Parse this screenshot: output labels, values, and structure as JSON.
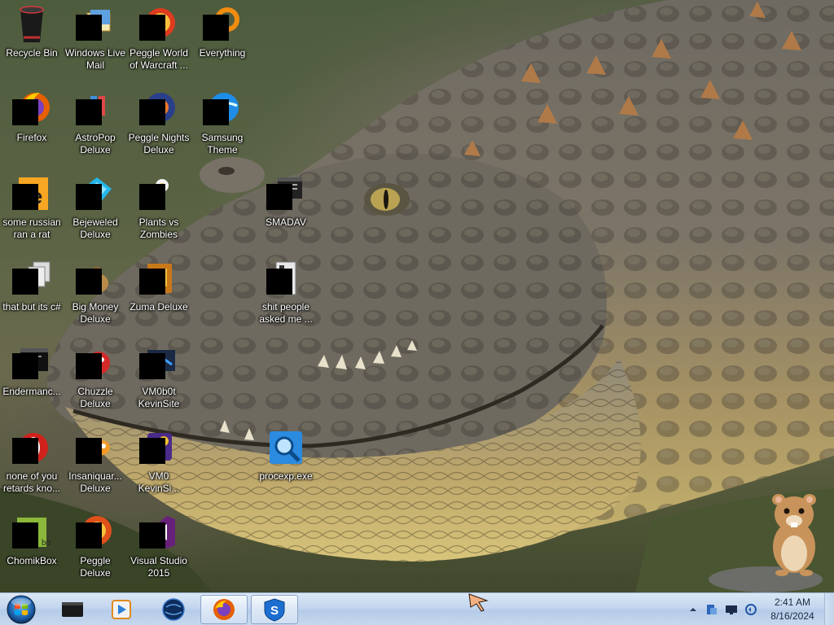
{
  "desktop_icons": [
    {
      "id": "recycle-bin",
      "label": "Recycle Bin",
      "icon": "recycle-bin-icon",
      "redacted": false
    },
    {
      "id": "windows-live-mail",
      "label": "Windows Live Mail",
      "icon": "mail-icon",
      "redacted": true
    },
    {
      "id": "peggle-world-of-warcraft",
      "label": "Peggle World of Warcraft ...",
      "icon": "peggle-wow-icon",
      "redacted": true
    },
    {
      "id": "everything",
      "label": "Everything",
      "icon": "everything-search-icon",
      "redacted": true
    },
    {
      "id": "firefox",
      "label": "Firefox",
      "icon": "firefox-icon",
      "redacted": true
    },
    {
      "id": "astropop-deluxe",
      "label": "AstroPop Deluxe",
      "icon": "astropop-icon",
      "redacted": true
    },
    {
      "id": "peggle-nights-deluxe",
      "label": "Peggle Nights Deluxe",
      "icon": "peggle-nights-icon",
      "redacted": true
    },
    {
      "id": "samsung-theme",
      "label": "Samsung Theme",
      "icon": "samsung-theme-icon",
      "redacted": true
    },
    {
      "id": "some-russian-ran-a-rat",
      "label": "some russian ran a rat",
      "icon": "ae-project-icon",
      "redacted": true
    },
    {
      "id": "bejeweled-deluxe",
      "label": "Bejeweled Deluxe",
      "icon": "bejeweled-icon",
      "redacted": true
    },
    {
      "id": "plants-vs-zombies",
      "label": "Plants vs Zombies",
      "icon": "pvz-icon",
      "redacted": true
    },
    {
      "id": "smadav",
      "label": "SMADAV",
      "icon": "shortcut-window-icon",
      "redacted": true
    },
    {
      "id": "that-but-its-csharp",
      "label": "that but its c#",
      "icon": "copy-stack-icon",
      "redacted": true
    },
    {
      "id": "big-money-deluxe",
      "label": "Big Money Deluxe",
      "icon": "money-bag-icon",
      "redacted": true
    },
    {
      "id": "zuma-deluxe",
      "label": "Zuma Deluxe",
      "icon": "zuma-icon",
      "redacted": true
    },
    {
      "id": "shit-people-asked-me",
      "label": "shit people asked me ...",
      "icon": "document-icon",
      "redacted": true
    },
    {
      "id": "endermanch",
      "label": "Endermanc...",
      "icon": "console-window-icon",
      "redacted": true
    },
    {
      "id": "chuzzle-deluxe",
      "label": "Chuzzle Deluxe",
      "icon": "chuzzle-icon",
      "redacted": true
    },
    {
      "id": "vm0b0t-kevinsite",
      "label": "VM0b0t KevinSite",
      "icon": "vm-icon",
      "redacted": true
    },
    {
      "id": "none-of-you-retards",
      "label": "none of you retards kno...",
      "icon": "opera-icon",
      "redacted": true
    },
    {
      "id": "insaniquarium-deluxe",
      "label": "Insaniquar... Deluxe",
      "icon": "fish-icon",
      "redacted": true
    },
    {
      "id": "vm0-kevinsite",
      "label": "VM0 KevinSi...",
      "icon": "purple-app-icon",
      "redacted": true
    },
    {
      "id": "procexp",
      "label": "procexp.exe",
      "icon": "process-explorer-icon",
      "redacted": false
    },
    {
      "id": "chomikbox",
      "label": "ChomikBox",
      "icon": "chomikbox-icon",
      "redacted": true
    },
    {
      "id": "peggle-deluxe",
      "label": "Peggle Deluxe",
      "icon": "peggle-icon",
      "redacted": true
    },
    {
      "id": "visual-studio-2015",
      "label": "Visual Studio 2015",
      "icon": "visual-studio-icon",
      "redacted": true
    }
  ],
  "taskbar": {
    "start_icon": "windows-start-orb-icon",
    "pinned": [
      {
        "id": "cmd",
        "icon": "terminal-icon",
        "active": false
      },
      {
        "id": "media-player",
        "icon": "media-player-icon",
        "active": false
      },
      {
        "id": "globe",
        "icon": "globe-icon",
        "active": false
      },
      {
        "id": "firefox",
        "icon": "firefox-icon",
        "active": true
      },
      {
        "id": "smadav",
        "icon": "smadav-shield-icon",
        "active": true
      }
    ],
    "tray": {
      "icons": [
        "show-hidden-icons-chevron-icon",
        "network-share-icon",
        "display-icon",
        "volume-icon"
      ],
      "time": "2:41 AM",
      "date": "8/16/2024"
    }
  },
  "colors": {
    "taskbar_top": "#dbe7f5",
    "taskbar_bottom": "#b5cbe8",
    "label_text": "#ffffff",
    "clock_text": "#1b2b40"
  }
}
